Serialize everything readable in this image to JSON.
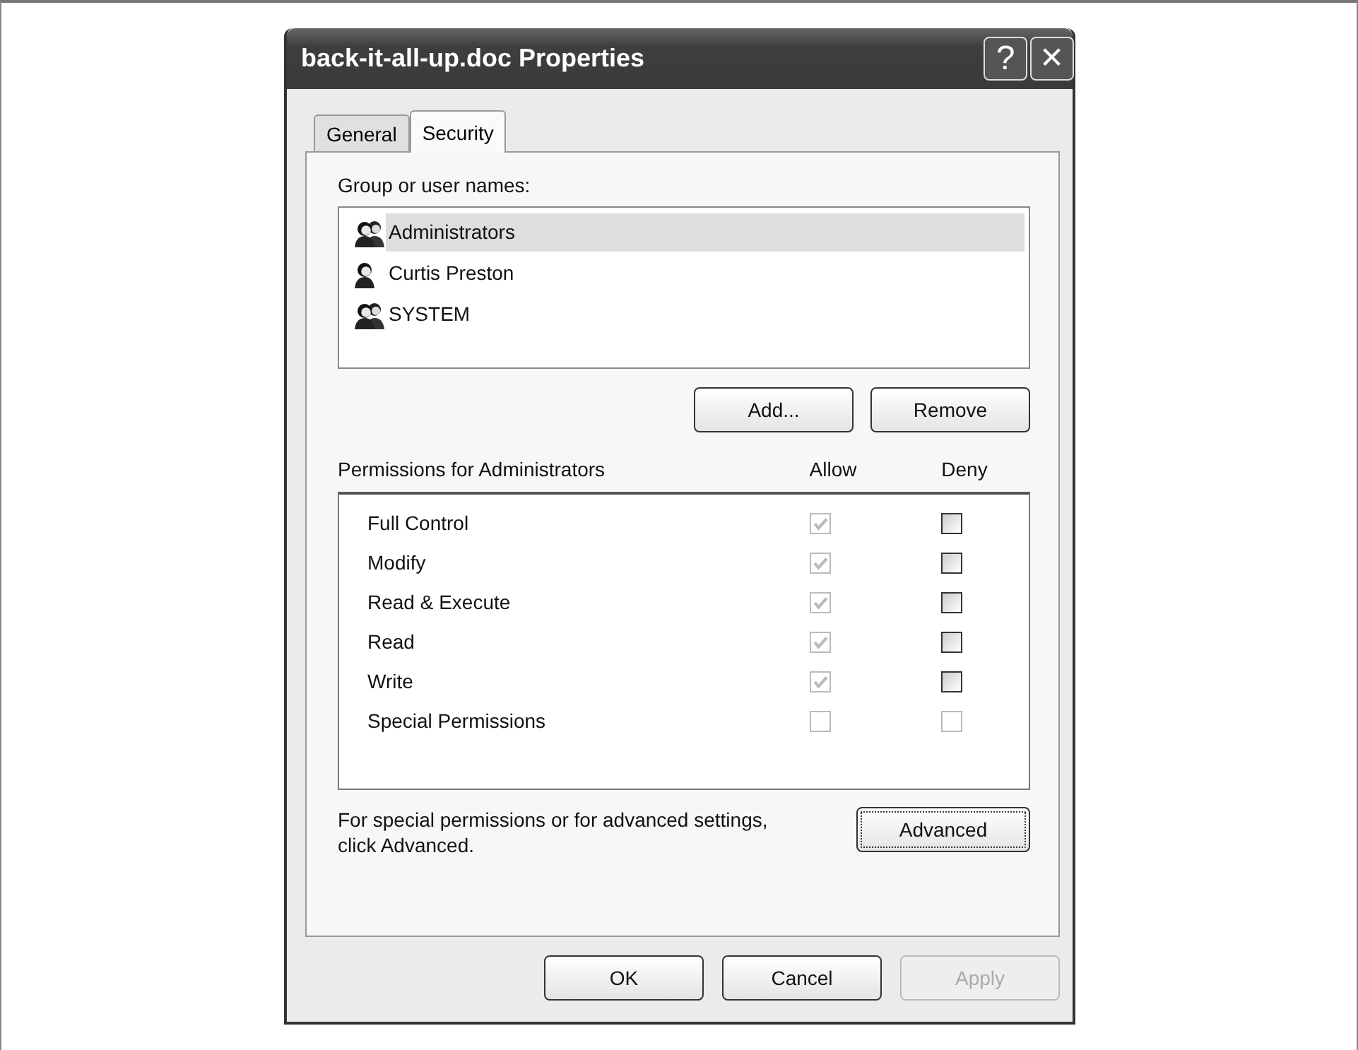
{
  "window": {
    "title": "back-it-all-up.doc Properties",
    "title_buttons": [
      {
        "kind": "help",
        "label": "?"
      },
      {
        "kind": "close",
        "label": "✕"
      }
    ]
  },
  "tabs": [
    {
      "label": "General",
      "selected": false
    },
    {
      "label": "Security",
      "selected": true
    }
  ],
  "names_label": "Group or user names:",
  "names": [
    {
      "name": "Administrators",
      "kind": "group",
      "selected": true
    },
    {
      "name": "Curtis Preston",
      "kind": "user",
      "selected": false
    },
    {
      "name": "SYSTEM",
      "kind": "group",
      "selected": false
    }
  ],
  "name_buttons": [
    {
      "label": "Add...",
      "disabled": false
    },
    {
      "label": "Remove",
      "disabled": false
    }
  ],
  "permissions": {
    "label": "Permissions for Administrators",
    "allow_header": "Allow",
    "deny_header": "Deny",
    "rows": [
      {
        "name": "Full Control",
        "allow": {
          "checked": true,
          "disabled": true
        },
        "deny": {
          "checked": false,
          "disabled": false
        }
      },
      {
        "name": "Modify",
        "allow": {
          "checked": true,
          "disabled": true
        },
        "deny": {
          "checked": false,
          "disabled": false
        }
      },
      {
        "name": "Read & Execute",
        "allow": {
          "checked": true,
          "disabled": true
        },
        "deny": {
          "checked": false,
          "disabled": false
        }
      },
      {
        "name": "Read",
        "allow": {
          "checked": true,
          "disabled": true
        },
        "deny": {
          "checked": false,
          "disabled": false
        }
      },
      {
        "name": "Write",
        "allow": {
          "checked": true,
          "disabled": true
        },
        "deny": {
          "checked": false,
          "disabled": false
        }
      },
      {
        "name": "Special Permissions",
        "allow": {
          "checked": false,
          "disabled": true
        },
        "deny": {
          "checked": false,
          "disabled": true
        }
      }
    ]
  },
  "advanced_text": "For special permissions or for advanced settings, click Advanced.",
  "advanced_button": "Advanced",
  "buttons": [
    {
      "label": "OK",
      "disabled": false
    },
    {
      "label": "Cancel",
      "disabled": false
    },
    {
      "label": "Apply",
      "disabled": true
    }
  ]
}
